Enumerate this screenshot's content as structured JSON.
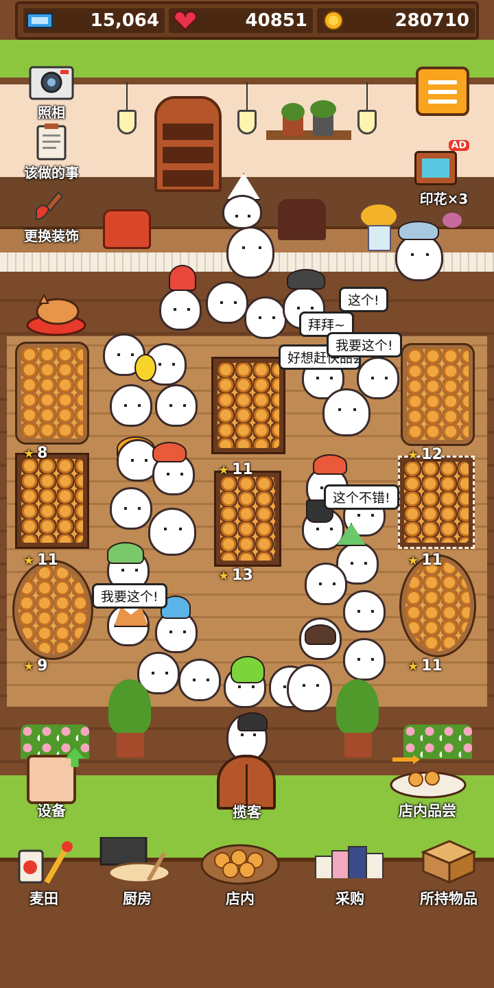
{
  "resources": {
    "tickets": "15,064",
    "hearts": "40851",
    "coins": "280710"
  },
  "left_menu": {
    "photo": "照相",
    "todo": "该做的事",
    "decor": "更换装饰"
  },
  "right_menu": {
    "stamps": "印花×3",
    "ad_badge": "AD"
  },
  "speech_bubbles": [
    "这个!",
    "拜拜~",
    "我要这个!",
    "好想赶快品尝",
    "这个不错!",
    "我要这个!"
  ],
  "table_stars": {
    "left_top": "8",
    "left_mid": "11",
    "left_bottom": "9",
    "center_top": "11",
    "center_mid": "13",
    "right_top": "12",
    "right_mid": "11",
    "right_bottom": "11"
  },
  "bottom_actions": {
    "equipment": "设备",
    "invite": "揽客",
    "tasting": "店内品尝"
  },
  "nav": [
    {
      "label": "麦田",
      "icon": "wheat-field-icon"
    },
    {
      "label": "厨房",
      "icon": "kitchen-icon"
    },
    {
      "label": "店内",
      "icon": "store-icon"
    },
    {
      "label": "采购",
      "icon": "shopping-icon"
    },
    {
      "label": "所持物品",
      "icon": "inventory-box-icon"
    }
  ],
  "colors": {
    "grass": "#8cc63f",
    "wood": "#7a4a2a",
    "menu_orange": "#f8a41e",
    "wall": "#f7dcc4"
  }
}
